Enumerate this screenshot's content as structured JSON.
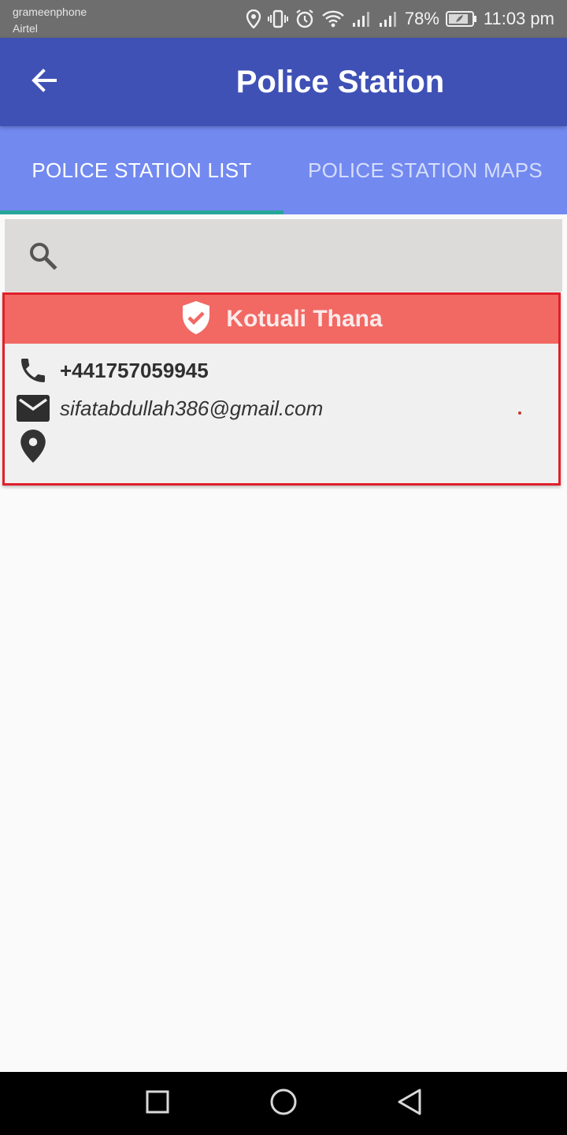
{
  "status_bar": {
    "carrier_1": "grameenphone",
    "carrier_2": "Airtel",
    "battery": "78%",
    "time": "11:03 pm",
    "icons": [
      "location-icon",
      "vibrate-icon",
      "alarm-icon",
      "wifi-icon",
      "signal-icon",
      "signal-icon",
      "battery-icon"
    ]
  },
  "app_bar": {
    "title": "Police Station",
    "back_icon": "arrow-left-icon",
    "color": "#3f51b5"
  },
  "tabs": [
    {
      "label": "POLICE STATION LIST",
      "active": true
    },
    {
      "label": "POLICE STATION MAPS",
      "active": false
    }
  ],
  "tabs_style": {
    "background": "#7289f0",
    "indicator_color": "#26a69a"
  },
  "search": {
    "icon": "search-icon",
    "value": ""
  },
  "stations": [
    {
      "name": "Kotuali Thana",
      "header_icon": "shield-check-icon",
      "phone": "+441757059945",
      "email": "sifatabdullah386@gmail.com",
      "address": "",
      "header_color": "#f26863",
      "border_color": "#e0202a"
    }
  ],
  "nav_bar": {
    "buttons": [
      "recent-apps-icon",
      "home-icon",
      "back-icon"
    ]
  }
}
